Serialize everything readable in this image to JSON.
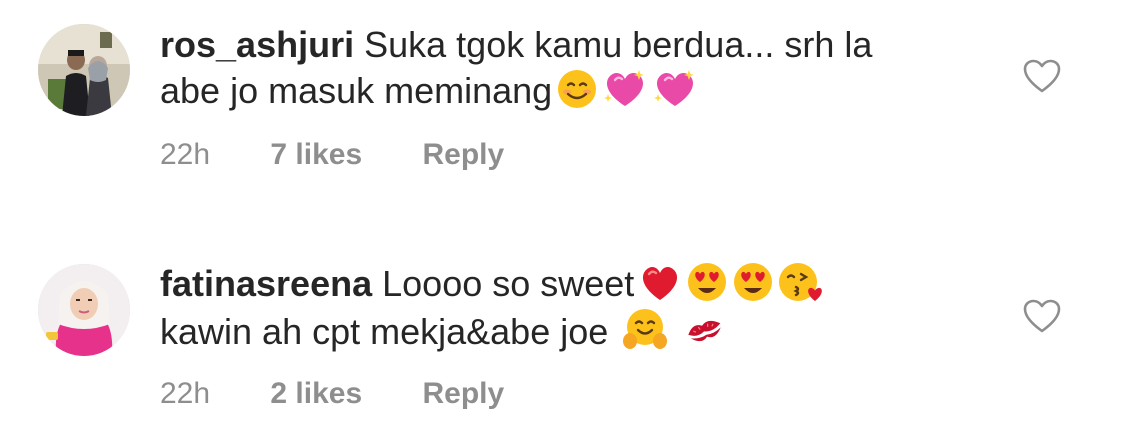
{
  "comments": [
    {
      "username": "ros_ashjuri",
      "text_line1": "Suka tgok kamu berdua... srh la",
      "text_line2": "abe jo masuk meminang",
      "emojis_line2": [
        "smiling-face-emoji",
        "sparkling-heart-emoji",
        "sparkling-heart-emoji"
      ],
      "time": "22h",
      "likes": "7 likes",
      "reply": "Reply",
      "like_icon": "heart-outline-icon"
    },
    {
      "username": "fatinasreena",
      "text_line1": "Loooo so sweet",
      "emojis_line1": [
        "red-heart-emoji",
        "heart-eyes-emoji",
        "heart-eyes-emoji",
        "face-blowing-kiss-emoji"
      ],
      "text_line2": "kawin ah cpt mekja&abe joe",
      "emojis_line2": [
        "hugging-face-emoji",
        "kiss-mark-emoji"
      ],
      "time": "22h",
      "likes": "2 likes",
      "reply": "Reply",
      "like_icon": "heart-outline-icon"
    }
  ],
  "colors": {
    "text": "#262626",
    "secondary": "#8e8e8e",
    "background": "#ffffff"
  }
}
